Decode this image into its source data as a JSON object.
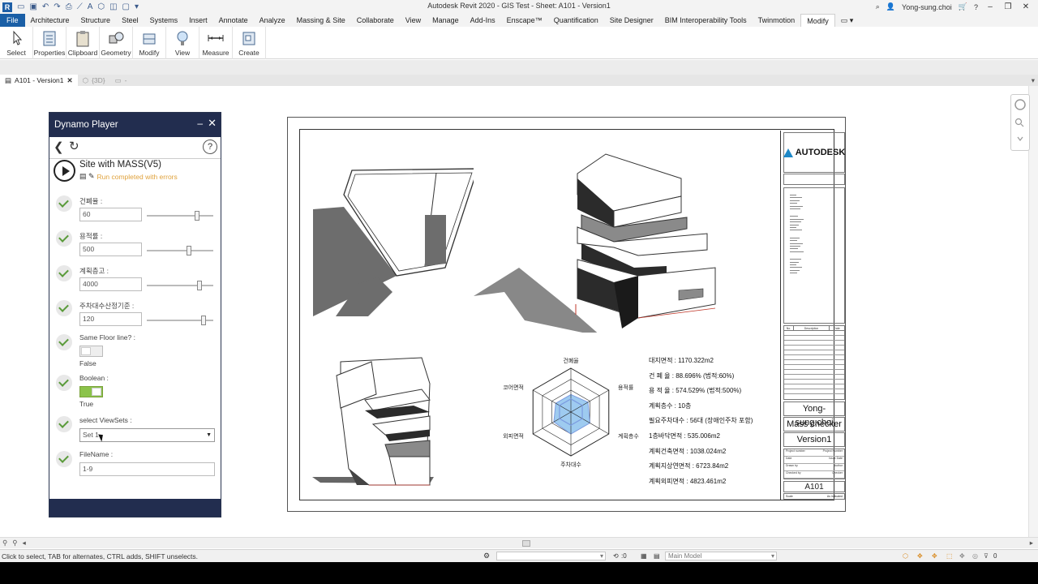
{
  "app": {
    "title": "Autodesk Revit 2020 - GIS Test - Sheet: A101 - Version1",
    "user": "Yong-sung.choi",
    "qat_items": [
      "R",
      "📂",
      "💾",
      "↶",
      "↷",
      "🖨",
      "⟋",
      "A",
      "⬡"
    ]
  },
  "ribbon_tabs": [
    "File",
    "Architecture",
    "Structure",
    "Steel",
    "Systems",
    "Insert",
    "Annotate",
    "Analyze",
    "Massing & Site",
    "Collaborate",
    "View",
    "Manage",
    "Add-Ins",
    "Enscape™",
    "Quantification",
    "Site Designer",
    "BIM Interoperability Tools",
    "Twinmotion",
    "Modify",
    "▭ ▾"
  ],
  "ribbon_buttons": [
    {
      "label": "Select",
      "icon": "cursor-icon"
    },
    {
      "label": "Properties",
      "icon": "properties-icon"
    },
    {
      "label": "Clipboard",
      "icon": "clipboard-icon"
    },
    {
      "label": "Geometry",
      "icon": "geometry-icon"
    },
    {
      "label": "Modify",
      "icon": "modify-icon"
    },
    {
      "label": "View",
      "icon": "bulb-icon"
    },
    {
      "label": "Measure",
      "icon": "measure-icon"
    },
    {
      "label": "Create",
      "icon": "create-icon"
    }
  ],
  "doc_tabs": {
    "active": "A101 - Version1",
    "inactive": "{3D}",
    "extra": "-"
  },
  "dynamo": {
    "title": "Dynamo Player",
    "script_name": "Site with MASS(V5)",
    "status": "Run completed with errors",
    "inputs": [
      {
        "label": "건폐율 :",
        "value": "60",
        "level": 0.78
      },
      {
        "label": "용적률 :",
        "value": "500",
        "level": 0.65
      },
      {
        "label": "계획층고 :",
        "value": "4000",
        "level": 0.82
      },
      {
        "label": "주차대수산정기준 :",
        "value": "120",
        "level": 0.88
      }
    ],
    "toggles": [
      {
        "label": "Same Floor line? :",
        "state": "False"
      },
      {
        "label": "Boolean :",
        "state": "True"
      }
    ],
    "viewsets": {
      "label": "select ViewSets :",
      "value": "Set 1"
    },
    "filename": {
      "label": "FileName :",
      "value": "1-9"
    }
  },
  "sheet": {
    "logo_text": "AUTODESK",
    "owner": "Yong-sung.choi",
    "project": "Mass checker",
    "version": "Version1",
    "sheet_number": "A101",
    "rev_headers": [
      "No.",
      "Description",
      "Date"
    ],
    "fields": [
      [
        "Project number",
        "Project Number"
      ],
      [
        "Date",
        "Issue Date"
      ],
      [
        "Drawn by",
        "Author"
      ],
      [
        "Checked by",
        "Checker"
      ]
    ],
    "scale_label": "Scale",
    "scale_value": "As indicated",
    "radar_labels": [
      "건폐율",
      "용적률",
      "계획층수",
      "주차대수",
      "외피면적",
      "코어면적"
    ],
    "radar_values": [
      0.4,
      0.45,
      0.5,
      0.5,
      0.45,
      0.4
    ],
    "stats": [
      "대지면적 : 1170.322m2",
      "건  폐  율 : 88.696% (법적:60%)",
      "용  적  율 : 574.529% (법적:500%)",
      "계획층수 : 10층",
      "필요주차대수 : 56대 (장애인주차 포함)",
      "1층바닥면적 : 535.006m2",
      "계획건축면적 : 1038.024m2",
      "계획지상연면적 : 6723.84m2",
      "계획외피면적 : 4823.461m2"
    ],
    "radar_fill": "#9ecbf0",
    "radar_core": "#7b9be0"
  },
  "status": {
    "message": "Click to select, TAB for alternates, CTRL adds, SHIFT unselects.",
    "model": "Main Model",
    "zero1": ":0",
    "zero2": "0"
  }
}
